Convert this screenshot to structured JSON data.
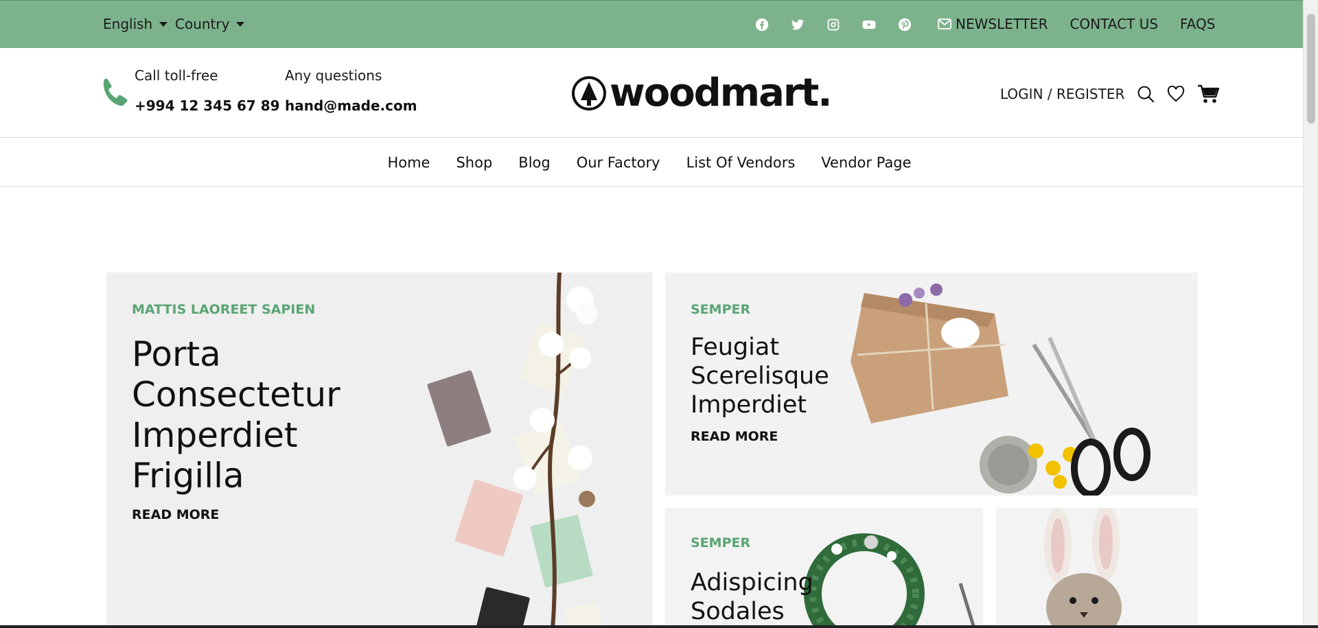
{
  "topbar": {
    "language": "English",
    "country": "Country",
    "socials": [
      "facebook-icon",
      "twitter-icon",
      "instagram-icon",
      "youtube-icon",
      "pinterest-icon"
    ],
    "links": {
      "newsletter": "NEWSLETTER",
      "contact": "CONTACT US",
      "faqs": "FAQS"
    },
    "bg_color": "#7db38c"
  },
  "header": {
    "call_label": "Call toll-free",
    "phone": "+994 12 345 67 89",
    "questions_label": "Any questions",
    "email": "hand@made.com",
    "logo_text": "woodmart.",
    "login": "LOGIN / REGISTER",
    "accent_color": "#5aa574"
  },
  "nav": {
    "items": [
      "Home",
      "Shop",
      "Blog",
      "Our Factory",
      "List Of Vendors",
      "Vendor Page"
    ]
  },
  "banners": [
    {
      "eyebrow": "MATTIS LAOREET SAPIEN",
      "title": [
        "Porta",
        "Consectetur",
        "Imperdiet",
        "Frigilla"
      ],
      "cta": "READ MORE"
    },
    {
      "eyebrow": "SEMPER",
      "title": [
        "Feugiat",
        "Scerelisque",
        "Imperdiet"
      ],
      "cta": "READ MORE"
    },
    {
      "eyebrow": "SEMPER",
      "title": [
        "Adispicing",
        "Sodales"
      ],
      "cta": ""
    }
  ]
}
